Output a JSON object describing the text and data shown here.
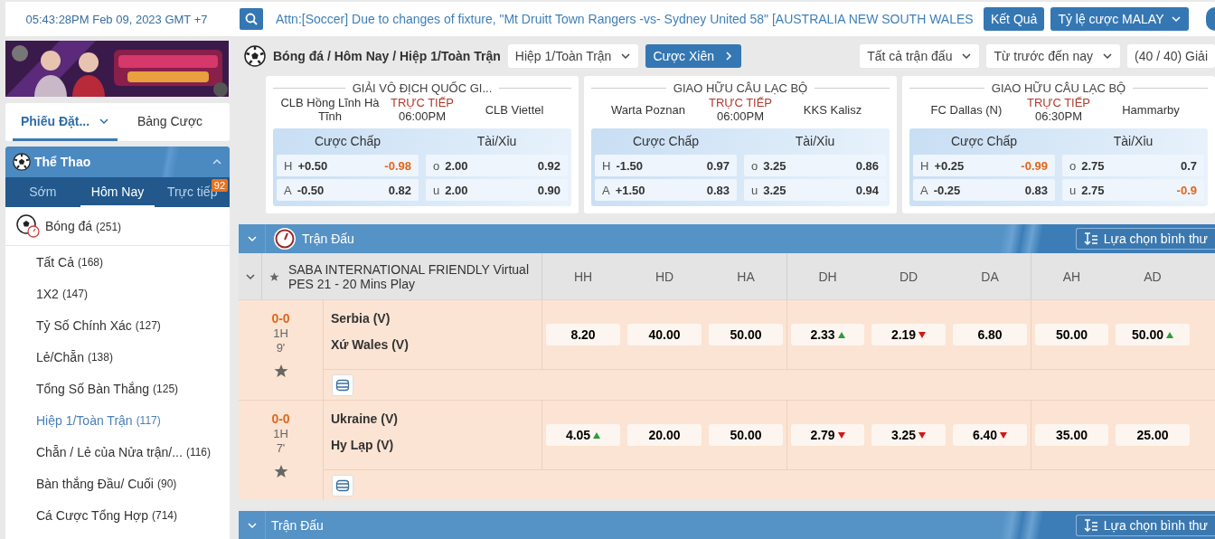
{
  "top_bar": {
    "clock": "05:43:28PM Feb 09, 2023 GMT +7",
    "ticker": "Attn:[Soccer] Due to changes of fixture, \"Mt Druitt Town Rangers -vs- Sydney United 58\" [AUSTRALIA NEW SOUTH WALES",
    "buttons": [
      {
        "label": "Kết Quả",
        "kind": "button"
      },
      {
        "label": "Tỷ lệ cược MALAY",
        "kind": "dropdown"
      }
    ]
  },
  "sidebar": {
    "tabs": [
      {
        "label": "Phiếu Đặt...",
        "selected": true,
        "dropdown": true
      },
      {
        "label": "Bảng Cược",
        "selected": false,
        "dropdown": false
      }
    ],
    "sports": {
      "title": "Thể Thao",
      "tabs": [
        {
          "label": "Sớm",
          "selected": false
        },
        {
          "label": "Hôm Nay",
          "selected": true
        },
        {
          "label": "Trực tiếp",
          "selected": false,
          "badge": "92"
        }
      ],
      "sport": {
        "label": "Bóng đá",
        "count": "(251)"
      },
      "items": [
        {
          "label": "Tất Cả",
          "count": "(168)",
          "selected": false
        },
        {
          "label": "1X2",
          "count": "(147)",
          "selected": false
        },
        {
          "label": "Tỷ Số Chính Xác",
          "count": "(127)",
          "selected": false
        },
        {
          "label": "Lẻ/Chẵn",
          "count": "(138)",
          "selected": false
        },
        {
          "label": "Tổng Số Bàn Thắng",
          "count": "(125)",
          "selected": false
        },
        {
          "label": "Hiệp 1/Toàn Trận",
          "count": "(117)",
          "selected": true
        },
        {
          "label": "Chẵn / Lẻ của Nửa trận/...",
          "count": "(116)",
          "selected": false
        },
        {
          "label": "Bàn thắng Đầu/ Cuối",
          "count": "(90)",
          "selected": false
        },
        {
          "label": "Cá Cược Tổng Hợp",
          "count": "(714)",
          "selected": false
        }
      ]
    }
  },
  "toolbar": {
    "breadcrumb": "Bóng đá / Hôm Nay / Hiệp 1/Toàn Trận",
    "market": "Hiệp 1/Toàn Trận",
    "parlay": "Cược Xiên",
    "filters": [
      "Tất cả trận đấu",
      "Từ trước đến nay",
      "(40 / 40) Giải"
    ]
  },
  "featured": [
    {
      "league": "GIẢI VÔ ĐỊCH QUỐC GI...",
      "home": "CLB Hồng Lĩnh Hà Tĩnh",
      "away": "CLB Viettel",
      "status": "TRỰC TIẾP",
      "time": "06:00PM",
      "markets": [
        {
          "title": "Cược Chấp",
          "rows": [
            {
              "label": "H",
              "line": "+0.50",
              "odds": "-0.98",
              "negative": true
            },
            {
              "label": "A",
              "line": "-0.50",
              "odds": "0.82",
              "negative": false
            }
          ]
        },
        {
          "title": "Tài/Xỉu",
          "rows": [
            {
              "label": "o",
              "line": "2.00",
              "odds": "0.92",
              "negative": false
            },
            {
              "label": "u",
              "line": "2.00",
              "odds": "0.90",
              "negative": false
            }
          ]
        }
      ]
    },
    {
      "league": "GIAO HỮU CÂU LẠC BỘ",
      "home": "Warta Poznan",
      "away": "KKS Kalisz",
      "status": "TRỰC TIẾP",
      "time": "06:00PM",
      "markets": [
        {
          "title": "Cược Chấp",
          "rows": [
            {
              "label": "H",
              "line": "-1.50",
              "odds": "0.97",
              "negative": false
            },
            {
              "label": "A",
              "line": "+1.50",
              "odds": "0.83",
              "negative": false
            }
          ]
        },
        {
          "title": "Tài/Xỉu",
          "rows": [
            {
              "label": "o",
              "line": "3.25",
              "odds": "0.86",
              "negative": false
            },
            {
              "label": "u",
              "line": "3.25",
              "odds": "0.94",
              "negative": false
            }
          ]
        }
      ]
    },
    {
      "league": "GIAO HỮU CÂU LẠC BỘ",
      "home": "FC Dallas (N)",
      "away": "Hammarby",
      "status": "TRỰC TIẾP",
      "time": "06:30PM",
      "markets": [
        {
          "title": "Cược Chấp",
          "rows": [
            {
              "label": "H",
              "line": "+0.25",
              "odds": "-0.99",
              "negative": true
            },
            {
              "label": "A",
              "line": "-0.25",
              "odds": "0.83",
              "negative": false
            }
          ]
        },
        {
          "title": "Tài/Xỉu",
          "rows": [
            {
              "label": "o",
              "line": "2.75",
              "odds": "0.7",
              "negative": false
            },
            {
              "label": "u",
              "line": "2.75",
              "odds": "-0.9",
              "negative": true
            }
          ]
        }
      ]
    }
  ],
  "sections": [
    {
      "title": "Trận Đấu",
      "live": true,
      "sort_button": "Lựa chọn bình thư",
      "league": {
        "name": "SABA INTERNATIONAL FRIENDLY Virtual PES 21 - 20 Mins Play",
        "columns": [
          "HH",
          "HD",
          "HA",
          "DH",
          "DD",
          "DA",
          "AH",
          "AD"
        ]
      },
      "matches": [
        {
          "score": "0-0",
          "period": "1H",
          "minute": "9'",
          "home": "Serbia (V)",
          "away": "Xứ Wales (V)",
          "odds": [
            {
              "value": "8.20",
              "kind": "plain"
            },
            {
              "value": "40.00",
              "kind": "plain"
            },
            {
              "value": "50.00",
              "kind": "plain"
            },
            {
              "value": "2.33",
              "kind": "up"
            },
            {
              "value": "2.19",
              "kind": "down"
            },
            {
              "value": "6.80",
              "kind": "plain"
            },
            {
              "value": "50.00",
              "kind": "plain"
            },
            {
              "value": "50.00",
              "kind": "up"
            }
          ]
        },
        {
          "score": "0-0",
          "period": "1H",
          "minute": "7'",
          "home": "Ukraine (V)",
          "away": "Hy Lạp (V)",
          "odds": [
            {
              "value": "4.05",
              "kind": "up"
            },
            {
              "value": "20.00",
              "kind": "plain"
            },
            {
              "value": "50.00",
              "kind": "plain"
            },
            {
              "value": "2.79",
              "kind": "down"
            },
            {
              "value": "3.25",
              "kind": "down"
            },
            {
              "value": "6.40",
              "kind": "down"
            },
            {
              "value": "35.00",
              "kind": "plain"
            },
            {
              "value": "25.00",
              "kind": "plain"
            }
          ]
        }
      ]
    },
    {
      "title": "Trận Đấu",
      "live": false,
      "sort_button": "Lựa chọn bình thư"
    }
  ]
}
